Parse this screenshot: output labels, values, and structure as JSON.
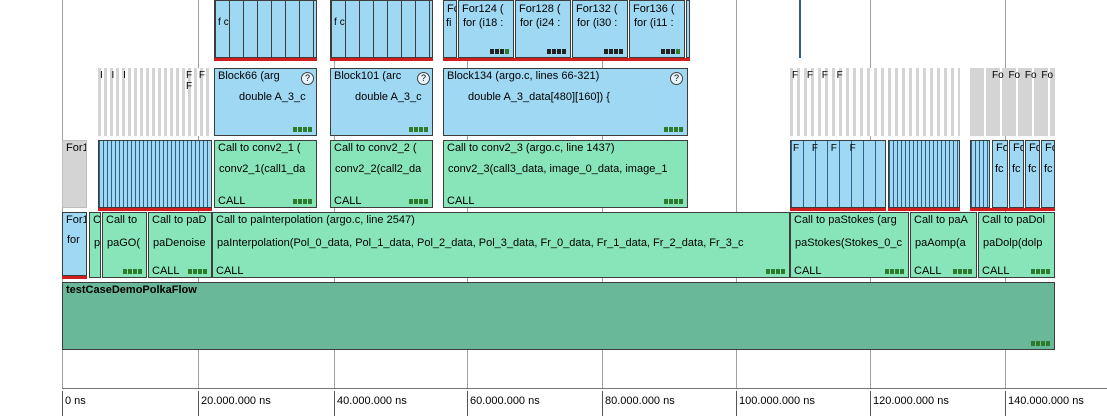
{
  "blocks": {
    "for1": "For1",
    "for1_sub": "For1",
    "for1_line2": "for",
    "c_small": "C",
    "c_small_line2": "p",
    "pagol_label": "Call to",
    "pagol_line2": "paGO(",
    "padenoise_label": "Call to paD",
    "padenoise_line2": "paDenoise",
    "padenoise_call": "CALL",
    "painterp_label": "Call to paInterpolation  (argo.c, line 2547)",
    "painterp_line2": "paInterpolation(Pol_0_data, Pol_1_data, Pol_2_data, Pol_3_data, Fr_0_data, Fr_1_data, Fr_2_data, Fr_3_c",
    "painterp_call": "CALL",
    "pastokes_label": "Call to paStokes  (arg",
    "pastokes_line2": "paStokes(Stokes_0_c",
    "pastokes_call": "CALL",
    "paaomp_label": "Call to paA",
    "paaomp_line2": "paAomp(a",
    "paaomp_call": "CALL",
    "padolp_label": "Call to paDol",
    "padolp_line2": "paDolp(dolp",
    "padolp_call": "CALL",
    "conv1_label": "Call to conv2_1  (",
    "conv1_line2": "conv2_1(call1_da",
    "conv1_call": "CALL",
    "conv2_label": "Call to conv2_2  (",
    "conv2_line2": "conv2_2(call2_da",
    "conv2_call": "CALL",
    "conv3_label": "Call to conv2_3  (argo.c, line 1437)",
    "conv3_line2": "conv2_3(call3_data, image_0_data, image_1",
    "conv3_call": "CALL",
    "block66_label": "Block66  (arg",
    "block66_line2": "double A_3_c",
    "block101_label": "Block101  (arc",
    "block101_line2": "double A_3_c",
    "block134_label": "Block134  (argo.c, lines 66-321)",
    "block134_line2": "double A_3_data[480][160]) {",
    "q": "?",
    "for124_label": "For124  (",
    "for124_line2": "for (i18 :",
    "for128_label": "For128  (",
    "for128_line2": "for (i24 :",
    "for132_label": "For132  (",
    "for132_line2": "for (i30 :",
    "for136_label": "For136  (",
    "for136_line2": "for (i11 :",
    "fc_short": "Fc",
    "fc_short_line2": "fi",
    "small_f": "F",
    "small_f_line2": "f",
    "small_fc": "fc",
    "small_fo": "Fo",
    "top_fo": "Fo Fo Fo Fo",
    "top_fff_left": "F F F",
    "top_fff_mid": "F  F F F",
    "top_iii": "I I I",
    "top_ffff": "F F F F",
    "fo_small": "Fo",
    "fo_line2": "fc",
    "testcase_label": "testCaseDemoPolkaFlow"
  },
  "axis": {
    "ticks": [
      "0 ns",
      "20.000.000 ns",
      "40.000.000 ns",
      "60.000.000 ns",
      "80.000.000 ns",
      "100.000.000 ns",
      "120.000.000 ns",
      "140.000.000 ns"
    ]
  },
  "colors": {
    "block_blue": "#9fd8f3",
    "call_green": "#88e4b9",
    "testcase_green": "#6ab89a",
    "marker_red": "#d11d1d"
  }
}
